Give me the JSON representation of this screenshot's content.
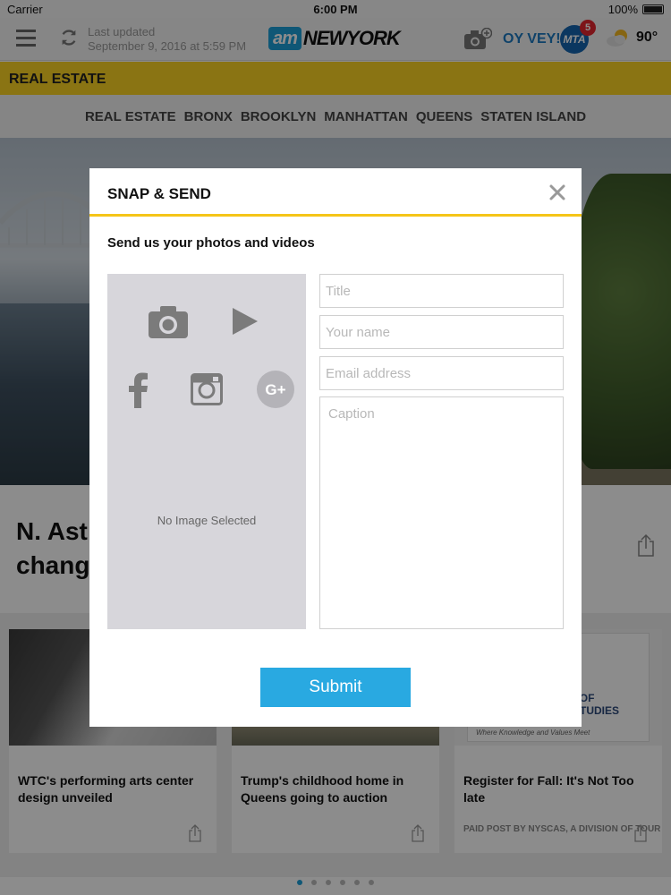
{
  "status_bar": {
    "carrier": "Carrier",
    "time": "6:00 PM",
    "battery": "100%"
  },
  "header": {
    "last_updated_label": "Last updated",
    "last_updated_time": "September 9, 2016 at 5:59 PM",
    "logo_am": "am",
    "logo_ny": "NEWYORK",
    "oy_vey": "OY VEY!",
    "mta_label": "MTA",
    "mta_badge": "5",
    "temperature": "90°"
  },
  "section": {
    "title": "REAL ESTATE"
  },
  "subnav": {
    "items": [
      "REAL ESTATE",
      "BRONX",
      "BROOKLYN",
      "MANHATTAN",
      "QUEENS",
      "STATEN ISLAND"
    ]
  },
  "article": {
    "title_line1": "N. Ast",
    "title_line2": "chang"
  },
  "cards": [
    {
      "title": "WTC's performing arts center design unveiled"
    },
    {
      "title": "Trump's childhood home in Queens going to auction"
    },
    {
      "title": "Register for Fall: It's Not Too late",
      "sponsor": "PAID POST BY NYSCAS, A DIVISION OF TOUR",
      "ad_line1": "OL OF",
      "ad_line2": "D STUDIES",
      "ad_tagline": "Where Knowledge and Values Meet"
    }
  ],
  "modal": {
    "title": "SNAP & SEND",
    "subtitle": "Send us your photos and videos",
    "no_image": "No Image Selected",
    "title_placeholder": "Title",
    "name_placeholder": "Your name",
    "email_placeholder": "Email address",
    "caption_placeholder": "Caption",
    "submit_label": "Submit"
  },
  "colors": {
    "accent_blue": "#29a9e1",
    "section_yellow": "#fcd424",
    "modal_divider": "#f5c518",
    "media_panel": "#d7d6db"
  },
  "icons": [
    "menu-icon",
    "refresh-icon",
    "camera-plus-icon",
    "weather-icon",
    "close-icon",
    "camera-icon",
    "play-icon",
    "facebook-icon",
    "instagram-icon",
    "google-plus-icon",
    "share-icon"
  ]
}
